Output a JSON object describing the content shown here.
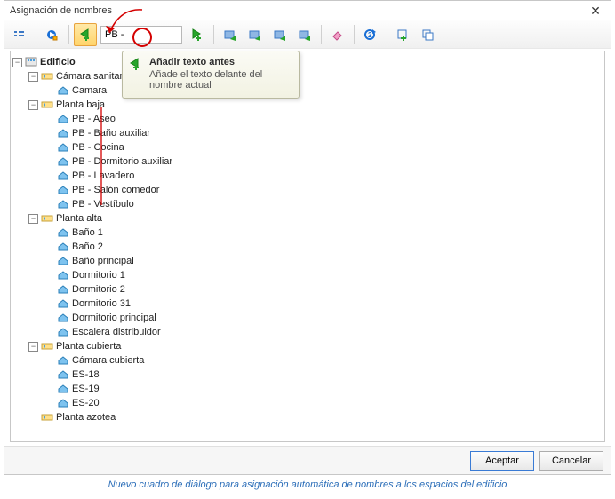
{
  "window": {
    "title": "Asignación de nombres",
    "close": "✕"
  },
  "toolbar": {
    "input_value": "PB - ",
    "btn_list": "list",
    "btn_play": "play",
    "btn_add_before": "add-text-before",
    "btn_add_after": "add-text-after",
    "btn_group1a": "tool-a",
    "btn_group1b": "tool-b",
    "btn_group1c": "tool-c",
    "btn_group1d": "tool-d",
    "btn_erase": "erase",
    "btn_refresh": "refresh",
    "btn_add_box": "add-box",
    "btn_copy": "copy"
  },
  "tooltip": {
    "title": "Añadir texto antes",
    "desc": "Añade el texto delante del nombre actual"
  },
  "tree": {
    "root": {
      "label": "Edificio",
      "children": [
        {
          "label": "Cámara sanitaria",
          "toggle": "-",
          "icon": "floor",
          "children": [
            {
              "label": "Camara",
              "icon": "space"
            }
          ]
        },
        {
          "label": "Planta baja",
          "toggle": "-",
          "icon": "floor",
          "children": [
            {
              "label": "PB - Aseo",
              "icon": "space"
            },
            {
              "label": "PB - Baño auxiliar",
              "icon": "space"
            },
            {
              "label": "PB - Cocina",
              "icon": "space"
            },
            {
              "label": "PB - Dormitorio auxiliar",
              "icon": "space"
            },
            {
              "label": "PB - Lavadero",
              "icon": "space"
            },
            {
              "label": "PB - Salón comedor",
              "icon": "space"
            },
            {
              "label": "PB - Vestíbulo",
              "icon": "space"
            }
          ]
        },
        {
          "label": "Planta alta",
          "toggle": "-",
          "icon": "floor",
          "children": [
            {
              "label": "Baño 1",
              "icon": "space"
            },
            {
              "label": "Baño 2",
              "icon": "space"
            },
            {
              "label": "Baño principal",
              "icon": "space"
            },
            {
              "label": "Dormitorio 1",
              "icon": "space"
            },
            {
              "label": "Dormitorio 2",
              "icon": "space"
            },
            {
              "label": "Dormitorio 31",
              "icon": "space"
            },
            {
              "label": "Dormitorio principal",
              "icon": "space"
            },
            {
              "label": "Escalera distribuidor",
              "icon": "space"
            }
          ]
        },
        {
          "label": "Planta cubierta",
          "toggle": "-",
          "icon": "floor",
          "children": [
            {
              "label": "Cámara cubierta",
              "icon": "space"
            },
            {
              "label": "ES-18",
              "icon": "space"
            },
            {
              "label": "ES-19",
              "icon": "space"
            },
            {
              "label": "ES-20",
              "icon": "space"
            }
          ]
        },
        {
          "label": "Planta azotea",
          "toggle": "",
          "icon": "floor",
          "children": []
        }
      ]
    }
  },
  "footer": {
    "ok": "Aceptar",
    "cancel": "Cancelar"
  },
  "caption": "Nuevo cuadro de diálogo para asignación automática de nombres a los espacios del edificio"
}
